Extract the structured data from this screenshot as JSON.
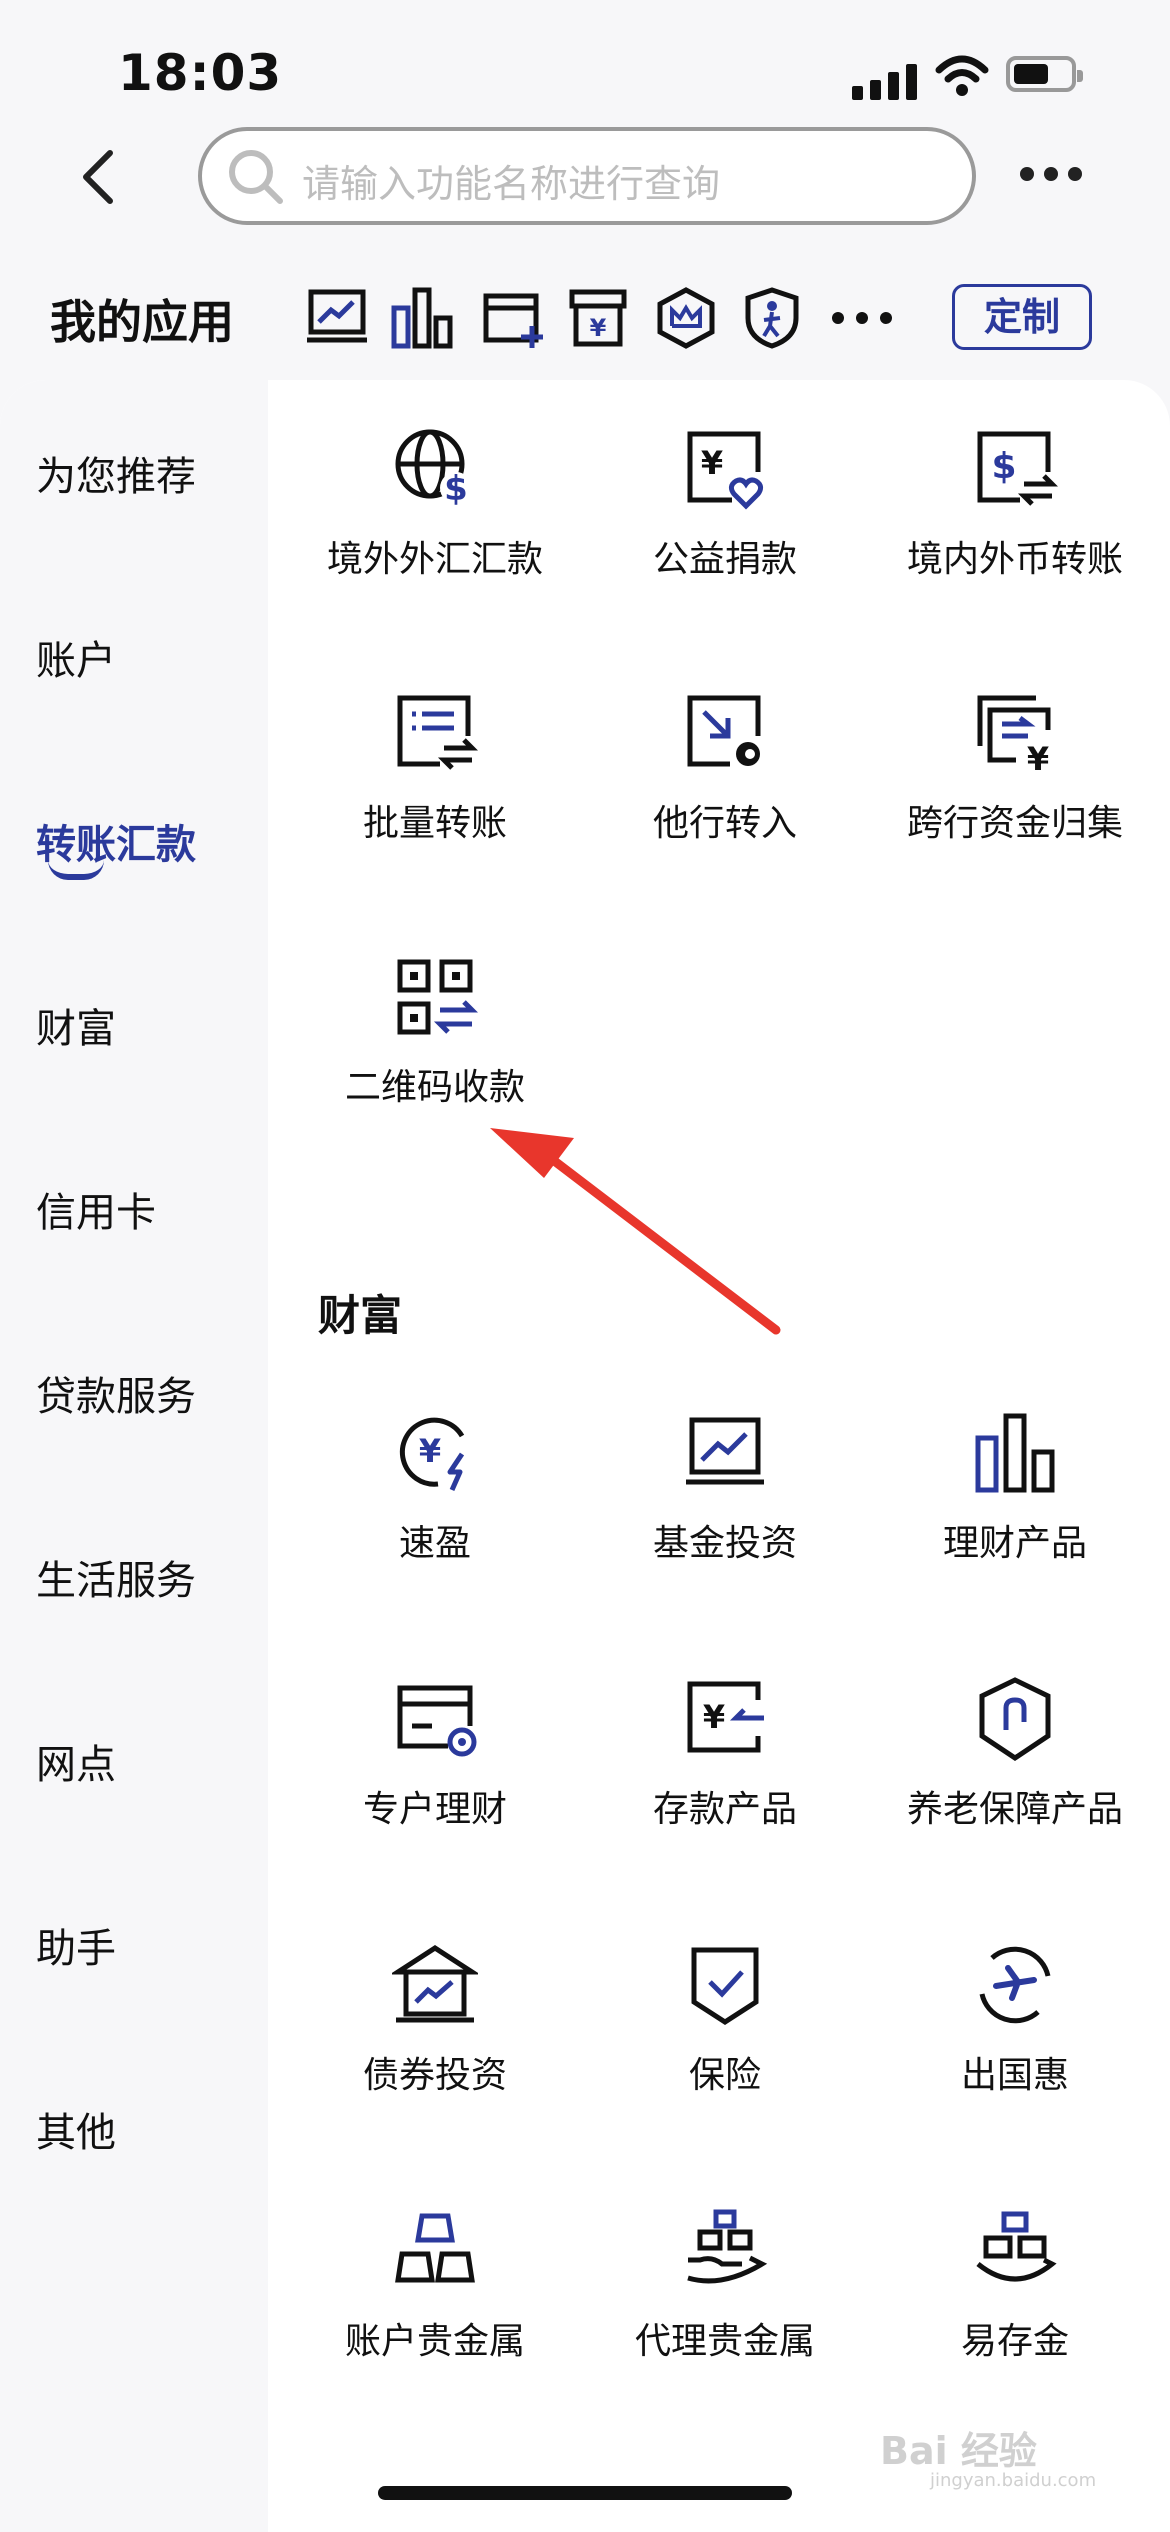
{
  "status_bar": {
    "time": "18:03"
  },
  "search": {
    "placeholder": "请输入功能名称进行查询"
  },
  "my_apps": {
    "title": "我的应用",
    "quick_icons": [
      "chart-icon",
      "bar-chart-icon",
      "card-add-icon",
      "yuan-box-icon",
      "crown-shield-icon",
      "person-shield-icon"
    ],
    "custom_label": "定制"
  },
  "sidebar": {
    "items": [
      {
        "label": "为您推荐",
        "active": false
      },
      {
        "label": "账户",
        "active": false
      },
      {
        "label": "转账汇款",
        "active": true
      },
      {
        "label": "财富",
        "active": false
      },
      {
        "label": "信用卡",
        "active": false
      },
      {
        "label": "贷款服务",
        "active": false
      },
      {
        "label": "生活服务",
        "active": false
      },
      {
        "label": "网点",
        "active": false
      },
      {
        "label": "助手",
        "active": false
      },
      {
        "label": "其他",
        "active": false
      }
    ]
  },
  "transfer_section": {
    "tiles": [
      {
        "label": "境外外汇汇款",
        "icon": "globe-dollar-icon"
      },
      {
        "label": "公益捐款",
        "icon": "donation-heart-icon"
      },
      {
        "label": "境内外币转账",
        "icon": "dollar-transfer-icon"
      },
      {
        "label": "批量转账",
        "icon": "batch-list-icon"
      },
      {
        "label": "他行转入",
        "icon": "incoming-transfer-icon"
      },
      {
        "label": "跨行资金归集",
        "icon": "fund-collection-icon"
      },
      {
        "label": "二维码收款",
        "icon": "qr-code-icon"
      }
    ]
  },
  "wealth_section": {
    "title": "财富",
    "tiles": [
      {
        "label": "速盈",
        "icon": "yuan-fast-icon"
      },
      {
        "label": "基金投资",
        "icon": "fund-chart-icon"
      },
      {
        "label": "理财产品",
        "icon": "bars-icon"
      },
      {
        "label": "专户理财",
        "icon": "card-coin-icon"
      },
      {
        "label": "存款产品",
        "icon": "deposit-icon"
      },
      {
        "label": "养老保障产品",
        "icon": "pension-shield-icon"
      },
      {
        "label": "债券投资",
        "icon": "bond-house-icon"
      },
      {
        "label": "保险",
        "icon": "insurance-check-icon"
      },
      {
        "label": "出国惠",
        "icon": "plane-globe-icon"
      },
      {
        "label": "账户贵金属",
        "icon": "gold-bars-icon"
      },
      {
        "label": "代理贵金属",
        "icon": "gold-hand-icon"
      },
      {
        "label": "易存金",
        "icon": "gold-save-icon"
      }
    ]
  },
  "watermark": {
    "text": "Bai 经验",
    "sub": "jingyan.baidu.com"
  },
  "colors": {
    "accent": "#2b3a9c",
    "arrow": "#e8362c"
  }
}
